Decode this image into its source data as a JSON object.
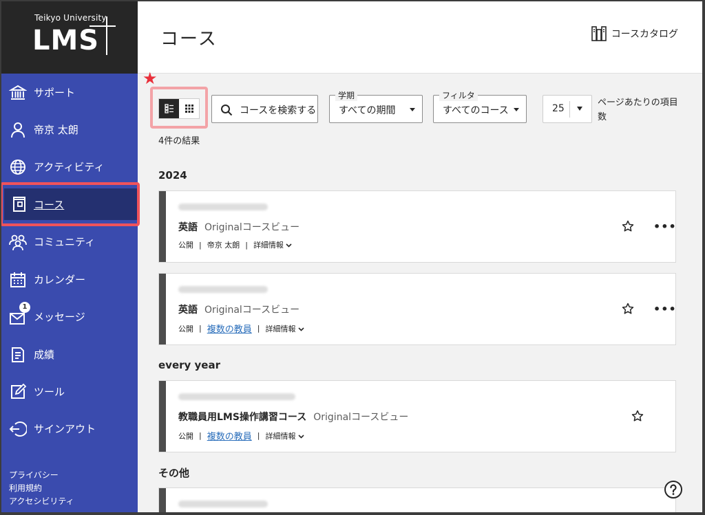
{
  "logo": {
    "university": "Teikyo University",
    "name": "LMS"
  },
  "sidebar": {
    "items": [
      {
        "label": "サポート",
        "icon": "bank-icon"
      },
      {
        "label": "帝京 太朗",
        "icon": "person-icon"
      },
      {
        "label": "アクティビティ",
        "icon": "globe-icon"
      },
      {
        "label": "コース",
        "icon": "book-icon",
        "active": true
      },
      {
        "label": "コミュニティ",
        "icon": "community-icon"
      },
      {
        "label": "カレンダー",
        "icon": "calendar-icon"
      },
      {
        "label": "メッセージ",
        "icon": "mail-icon",
        "badge": "1"
      },
      {
        "label": "成績",
        "icon": "grades-icon"
      },
      {
        "label": "ツール",
        "icon": "tools-icon"
      },
      {
        "label": "サインアウト",
        "icon": "signout-icon"
      }
    ],
    "footer": [
      "プライバシー",
      "利用規約",
      "アクセシビリティ"
    ]
  },
  "header": {
    "title": "コース",
    "catalog_label": "コースカタログ"
  },
  "toolbar": {
    "search_placeholder": "コースを検索する",
    "term": {
      "label": "学期",
      "value": "すべての期間"
    },
    "filter": {
      "label": "フィルタ",
      "value": "すべてのコース"
    },
    "per_page": {
      "value": "25",
      "label": "ページあたりの項目数"
    }
  },
  "results_text": "4件の結果",
  "groups": [
    {
      "title": "2024"
    },
    {
      "title": "every year"
    },
    {
      "title": "その他"
    }
  ],
  "courses": [
    {
      "name": "英語",
      "view": "Originalコースビュー",
      "status": "公開",
      "instructor": "帝京 太朗",
      "instructor_link": false,
      "details": "詳細情報"
    },
    {
      "name": "英語",
      "view": "Originalコースビュー",
      "status": "公開",
      "instructor": "複数の教員",
      "instructor_link": true,
      "details": "詳細情報"
    },
    {
      "name": "教職員用LMS操作講習コース",
      "view": "Originalコースビュー",
      "status": "公開",
      "instructor": "複数の教員",
      "instructor_link": true,
      "details": "詳細情報"
    }
  ],
  "colors": {
    "sidebar": "#3a4bae",
    "active_item": "#243070",
    "highlight": "#f0535b",
    "link": "#2a6ebb"
  }
}
